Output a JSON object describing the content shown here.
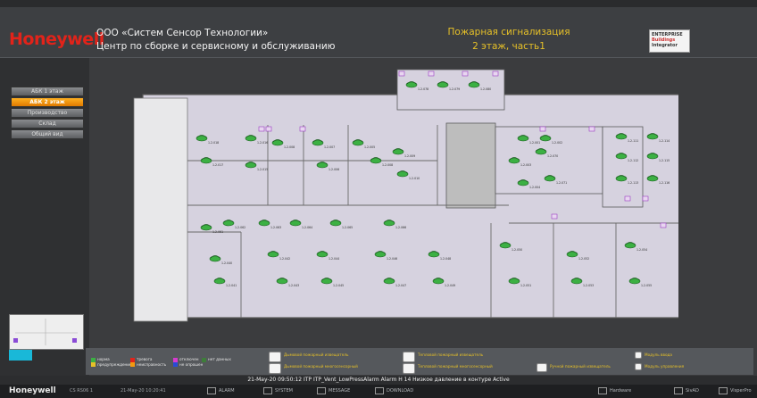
{
  "header": {
    "logo": "Honeywell",
    "company_line1": "ООО «Систем Сенсор Технологии»",
    "company_line2": "Центр по сборке и сервисному и обслуживанию",
    "system_line1": "Пожарная сигнализация",
    "system_line2": "2 этаж, часть1",
    "badge_line1": "ENTERPRISE",
    "badge_line2": "Buildings",
    "badge_line3": "Integrator"
  },
  "sidebar": {
    "items": [
      {
        "label": "АБК 1 этаж",
        "active": false
      },
      {
        "label": "АБК 2 этаж",
        "active": true
      },
      {
        "label": "Производство",
        "active": false
      },
      {
        "label": "Склад",
        "active": false
      },
      {
        "label": "Общий вид",
        "active": false
      }
    ]
  },
  "floor": {
    "sensors": [
      {
        "id": "1.2.078"
      },
      {
        "id": "1.2.079"
      },
      {
        "id": "1.2.080"
      },
      {
        "id": "1.2.018"
      },
      {
        "id": "1.2.017"
      },
      {
        "id": "1.2.016"
      },
      {
        "id": "1.2.015"
      },
      {
        "id": "1.2.008"
      },
      {
        "id": "1.2.007"
      },
      {
        "id": "1.2.006"
      },
      {
        "id": "1.2.005"
      },
      {
        "id": "1.2.008"
      },
      {
        "id": "1.2.009"
      },
      {
        "id": "1.2.010"
      },
      {
        "id": "1.2.001"
      },
      {
        "id": "1.2.002"
      },
      {
        "id": "1.2.003"
      },
      {
        "id": "1.2.004"
      },
      {
        "id": "1.2.070"
      },
      {
        "id": "1.2.071"
      },
      {
        "id": "1.2.061"
      },
      {
        "id": "1.2.062"
      },
      {
        "id": "1.2.063"
      },
      {
        "id": "1.2.064"
      },
      {
        "id": "1.2.065"
      },
      {
        "id": "1.2.066"
      },
      {
        "id": "1.2.040"
      },
      {
        "id": "1.2.041"
      },
      {
        "id": "1.2.042"
      },
      {
        "id": "1.2.043"
      },
      {
        "id": "1.2.044"
      },
      {
        "id": "1.2.045"
      },
      {
        "id": "1.2.046"
      },
      {
        "id": "1.2.047"
      },
      {
        "id": "1.2.048"
      },
      {
        "id": "1.2.049"
      },
      {
        "id": "1.2.050"
      },
      {
        "id": "1.2.051"
      },
      {
        "id": "1.2.052"
      },
      {
        "id": "1.2.053"
      },
      {
        "id": "1.2.054"
      },
      {
        "id": "1.2.055"
      },
      {
        "id": "1.2.111"
      },
      {
        "id": "1.2.112"
      },
      {
        "id": "1.2.113"
      },
      {
        "id": "1.2.114"
      },
      {
        "id": "1.2.115"
      },
      {
        "id": "1.2.116"
      }
    ]
  },
  "legend": {
    "col1": [
      "норма",
      "предупреждение"
    ],
    "col2": [
      "тревога",
      "неисправность"
    ],
    "col3": [
      "отключен",
      "не опрошен"
    ],
    "col4": [
      "нет данных"
    ],
    "sensor_smoke": "Дымовой пожарный извещатель",
    "sensor_smoke_multi": "Дымовой пожарный многосенсорный",
    "sensor_heat": "Тепловой пожарный извещатель",
    "sensor_heat_multi": "Тепловой пожарный многосенсорный",
    "manual": "Ручной пожарный извещатель",
    "module_in": "Модуль ввода",
    "module_out": "Модуль управления"
  },
  "event": {
    "text": "21-May-20 09:50:12 ITP ITP_Vent_LowPressAlarm Alarm H 14 Низкое давление в контуре Active"
  },
  "statusbar": {
    "logo": "Honeywell",
    "station": "CS RS06 1",
    "datetime": "21-May-20 10:20:41",
    "btn_alarm": "ALARM",
    "btn_system": "SYSTEM",
    "btn_message": "MESSAGE",
    "btn_download": "DOWNLOAD",
    "right1": "Hardware",
    "right2": "SivAD",
    "right3": "VisperPro"
  },
  "colors": {
    "alarm_yellow": "#e6c028",
    "logo_red": "#e2231a",
    "active_tab": "#f39a10",
    "sensor_green": "#3cb043",
    "floor_room": "#d6d2df"
  }
}
